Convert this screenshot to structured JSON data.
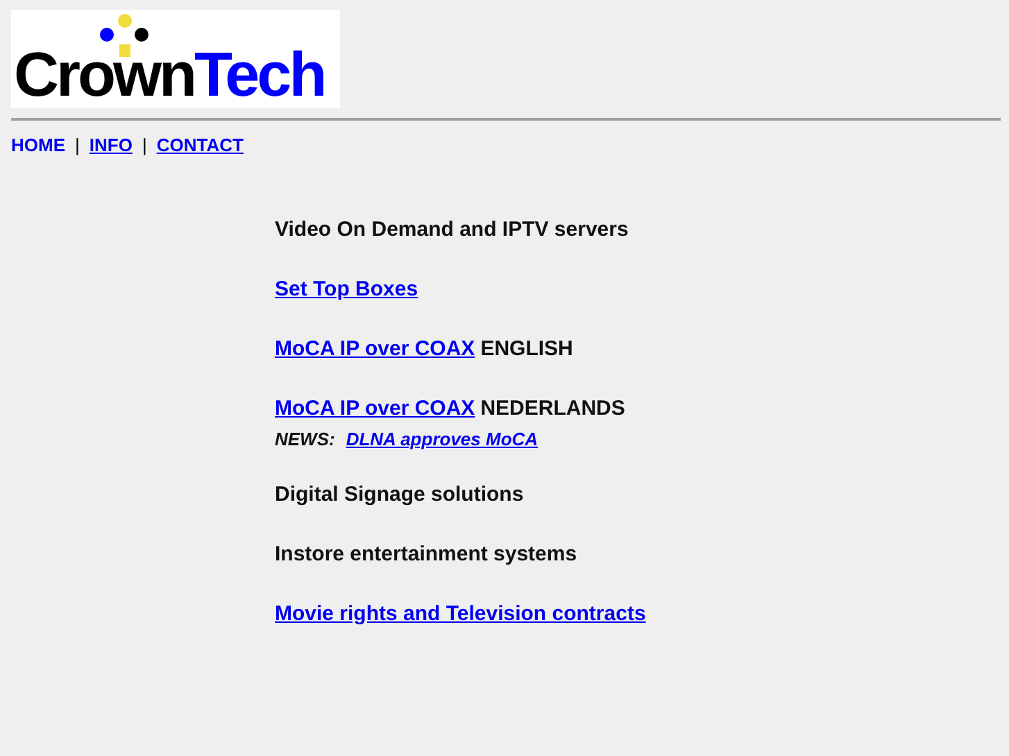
{
  "logo": {
    "parts": [
      {
        "text": "Crown",
        "color": "#000000"
      },
      {
        "text": "Tech",
        "color": "#0000ff"
      }
    ]
  },
  "nav": [
    {
      "label": "HOME",
      "link": false
    },
    {
      "label": "INFO",
      "link": true
    },
    {
      "label": "CONTACT",
      "link": true
    }
  ],
  "nav_separator": "|",
  "blocks": [
    [
      {
        "kind": "line",
        "parts": [
          {
            "text": "Video On Demand and IPTV servers",
            "link": false
          }
        ]
      }
    ],
    [
      {
        "kind": "line",
        "parts": [
          {
            "text": "Set Top Boxes",
            "link": true
          }
        ]
      }
    ],
    [
      {
        "kind": "line",
        "parts": [
          {
            "text": "MoCA IP over COAX",
            "link": true
          },
          {
            "text": "ENGLISH",
            "link": false
          }
        ]
      }
    ],
    [
      {
        "kind": "line",
        "parts": [
          {
            "text": "MoCA IP over COAX",
            "link": true
          },
          {
            "text": "NEDERLANDS",
            "link": false
          }
        ]
      },
      {
        "kind": "news",
        "parts": [
          {
            "text": "NEWS:",
            "link": false
          },
          {
            "text": "DLNA approves MoCA",
            "link": true
          }
        ]
      }
    ],
    [
      {
        "kind": "line",
        "parts": [
          {
            "text": "Digital Signage solutions",
            "link": false
          }
        ]
      }
    ],
    [
      {
        "kind": "line",
        "parts": [
          {
            "text": "Instore entertainment systems",
            "link": false
          }
        ]
      }
    ],
    [
      {
        "kind": "line",
        "parts": [
          {
            "text": "Movie rights and Television contracts",
            "link": true
          }
        ]
      }
    ]
  ]
}
